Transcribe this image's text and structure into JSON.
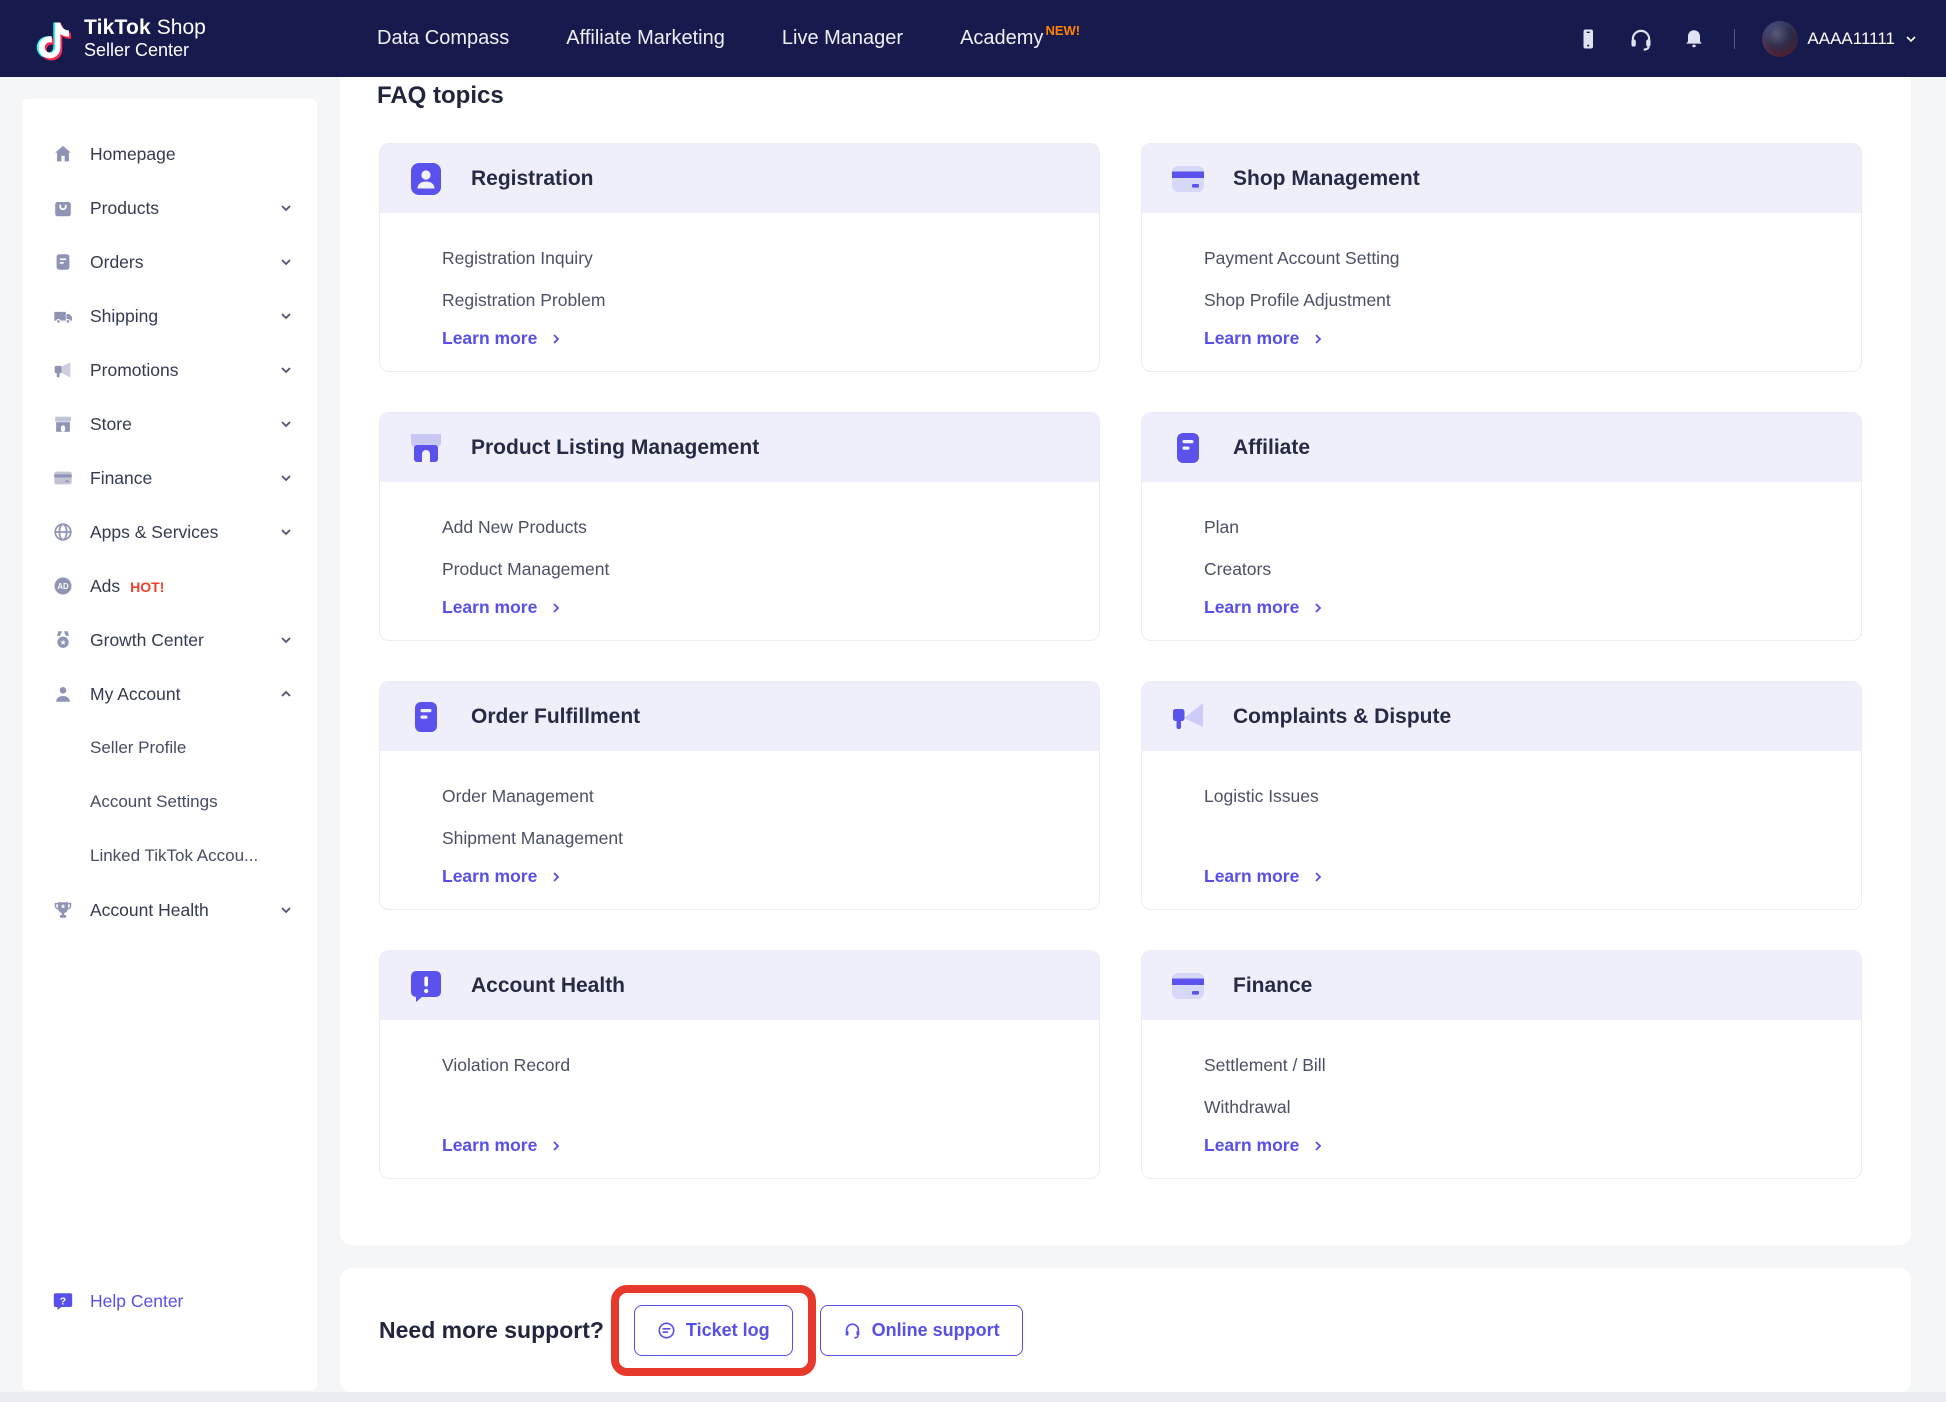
{
  "topnav": {
    "brand_bold": "TikTok",
    "brand_shop": "Shop",
    "brand_line2": "Seller Center",
    "links": [
      {
        "label": "Data Compass",
        "badge": ""
      },
      {
        "label": "Affiliate Marketing",
        "badge": ""
      },
      {
        "label": "Live Manager",
        "badge": ""
      },
      {
        "label": "Academy",
        "badge": "NEW!"
      }
    ],
    "account_name": "AAAA11111"
  },
  "sidebar": {
    "items": [
      {
        "label": "Homepage"
      },
      {
        "label": "Products"
      },
      {
        "label": "Orders"
      },
      {
        "label": "Shipping"
      },
      {
        "label": "Promotions"
      },
      {
        "label": "Store"
      },
      {
        "label": "Finance"
      },
      {
        "label": "Apps & Services"
      },
      {
        "label": "Ads",
        "badge": "HOT!"
      },
      {
        "label": "Growth Center"
      },
      {
        "label": "My Account"
      },
      {
        "label": "Account Health"
      }
    ],
    "my_account_subitems": [
      "Seller Profile",
      "Account Settings",
      "Linked TikTok Accou..."
    ],
    "help_label": "Help Center"
  },
  "main": {
    "heading": "FAQ topics",
    "learn_more_label": "Learn more",
    "cards": [
      {
        "title": "Registration",
        "items": [
          "Registration Inquiry",
          "Registration Problem"
        ]
      },
      {
        "title": "Shop Management",
        "items": [
          "Payment Account Setting",
          "Shop Profile Adjustment"
        ]
      },
      {
        "title": "Product Listing Management",
        "items": [
          "Add New Products",
          "Product Management"
        ]
      },
      {
        "title": "Affiliate",
        "items": [
          "Plan",
          "Creators"
        ]
      },
      {
        "title": "Order Fulfillment",
        "items": [
          "Order Management",
          "Shipment Management"
        ]
      },
      {
        "title": "Complaints & Dispute",
        "items": [
          "Logistic Issues"
        ]
      },
      {
        "title": "Account Health",
        "items": [
          "Violation Record"
        ]
      },
      {
        "title": "Finance",
        "items": [
          "Settlement / Bill",
          "Withdrawal"
        ]
      }
    ]
  },
  "support": {
    "prompt": "Need more support?",
    "ticket_button": "Ticket log",
    "online_button": "Online support"
  },
  "colors": {
    "navbar": "#171a4d",
    "accent": "#584feb",
    "card_header": "#efeffc",
    "hot_badge": "#f43f2e",
    "new_badge": "#ff8200",
    "highlight_box": "#e6392c"
  }
}
